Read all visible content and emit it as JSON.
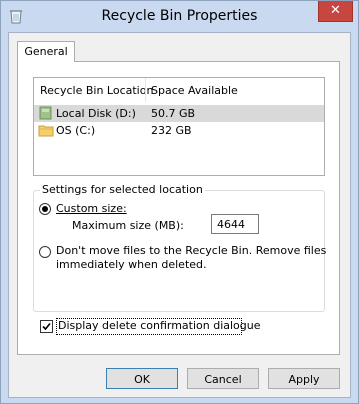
{
  "window": {
    "title": "Recycle Bin Properties",
    "close_glyph": "✕"
  },
  "tabs": [
    {
      "label": "General"
    }
  ],
  "list": {
    "columns": [
      "Recycle Bin Location",
      "Space Available"
    ],
    "rows": [
      {
        "location": "Local Disk (D:)",
        "space": "50.7 GB",
        "icon": "drive-icon",
        "selected": true
      },
      {
        "location": "OS (C:)",
        "space": "232 GB",
        "icon": "folder-icon",
        "selected": false
      }
    ]
  },
  "settings": {
    "group_label": "Settings for selected location",
    "custom_size_label": "Custom size:",
    "max_size_label": "Maximum size (MB):",
    "max_size_value": "4644",
    "dont_move_label_line1": "Don't move files to the Recycle Bin. Remove files",
    "dont_move_label_line2": "immediately when deleted."
  },
  "confirm": {
    "label": "Display delete confirmation dialogue",
    "checked": true
  },
  "buttons": {
    "ok": "OK",
    "cancel": "Cancel",
    "apply": "Apply"
  },
  "colors": {
    "title_bar": "#c9d9ef",
    "close_button": "#c7463f",
    "selected_row": "#d9d9d9"
  }
}
